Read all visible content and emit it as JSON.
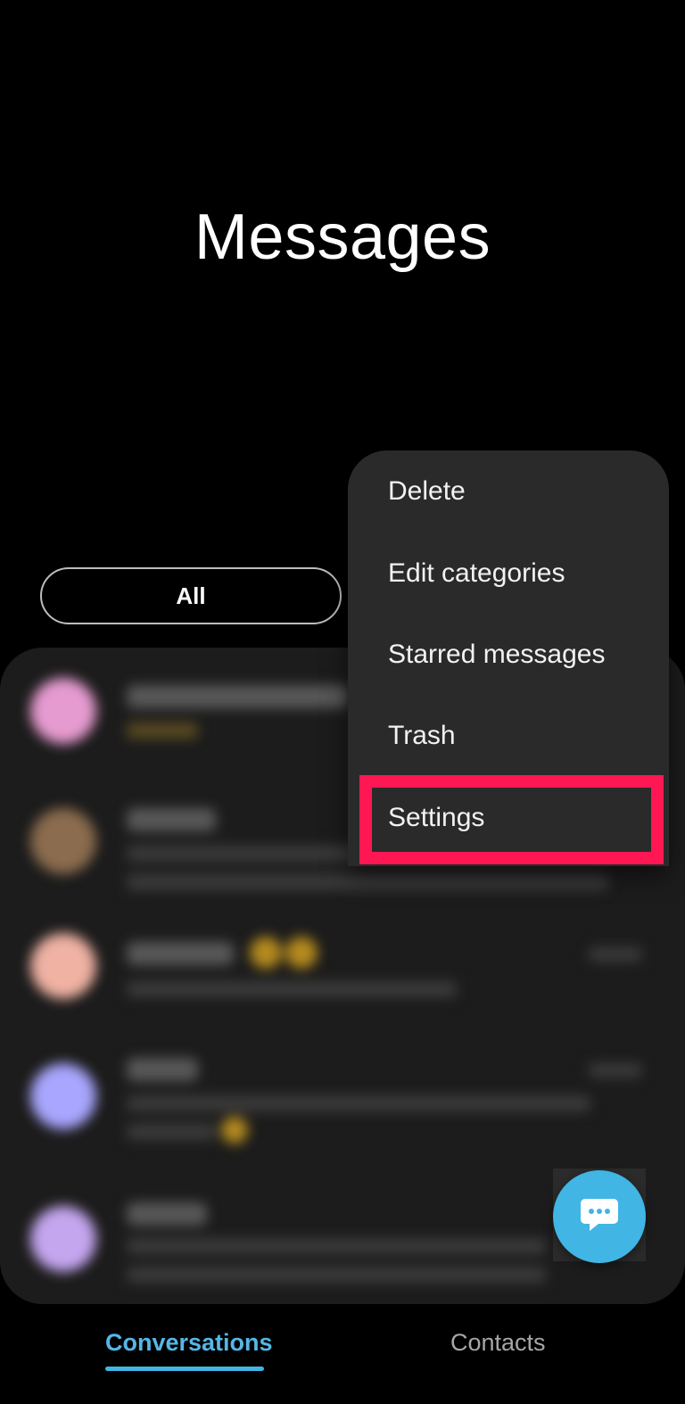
{
  "header": {
    "title": "Messages"
  },
  "filters": {
    "active_label": "All"
  },
  "menu": {
    "items": [
      {
        "label": "Delete"
      },
      {
        "label": "Edit categories"
      },
      {
        "label": "Starred messages"
      },
      {
        "label": "Trash"
      },
      {
        "label": "Settings",
        "highlighted": true
      }
    ],
    "highlight_color": "#ff1753"
  },
  "fab": {
    "icon": "chat-bubble-icon",
    "color": "#41b5e4"
  },
  "bottom_nav": {
    "tabs": [
      {
        "label": "Conversations",
        "active": true
      },
      {
        "label": "Contacts",
        "active": false
      }
    ],
    "active_color": "#55b7e6"
  },
  "conversations": {
    "avatar_colors": [
      "#e69bd0",
      "#8b6c4e",
      "#efb2a3",
      "#a9a6ff",
      "#c4a6ef"
    ]
  }
}
